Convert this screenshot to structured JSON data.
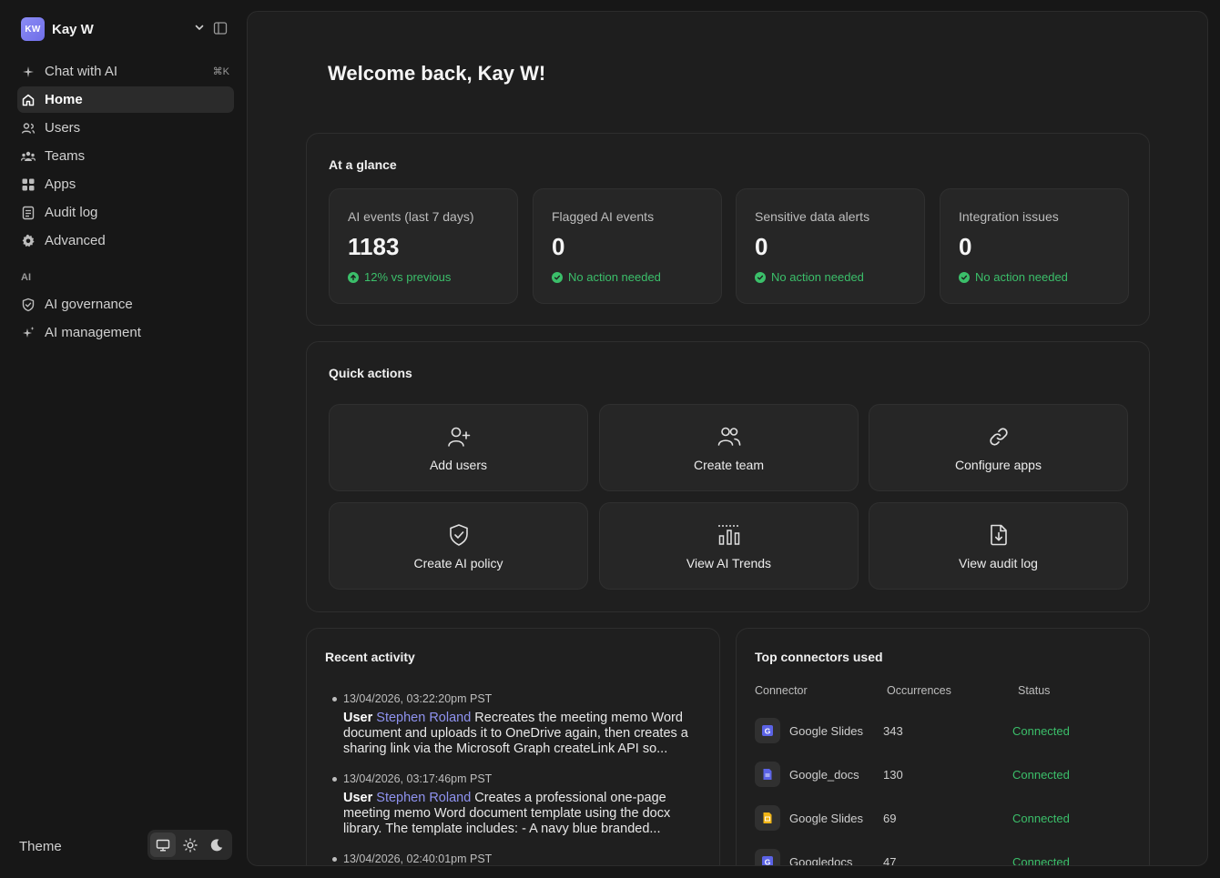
{
  "account": {
    "initials": "KW",
    "name": "Kay W"
  },
  "nav": {
    "chat": {
      "label": "Chat with AI",
      "shortcut": "⌘K"
    },
    "items": [
      {
        "label": "Home"
      },
      {
        "label": "Users"
      },
      {
        "label": "Teams"
      },
      {
        "label": "Apps"
      },
      {
        "label": "Audit log"
      },
      {
        "label": "Advanced"
      }
    ],
    "ai_section_label": "AI",
    "ai_items": [
      {
        "label": "AI governance"
      },
      {
        "label": "AI management"
      }
    ]
  },
  "theme": {
    "label": "Theme"
  },
  "welcome": "Welcome back, Kay W!",
  "glance": {
    "title": "At a glance",
    "stats": [
      {
        "label": "AI events (last 7 days)",
        "value": "1183",
        "foot": "12% vs previous"
      },
      {
        "label": "Flagged AI events",
        "value": "0",
        "foot": "No action needed"
      },
      {
        "label": "Sensitive data alerts",
        "value": "0",
        "foot": "No action needed"
      },
      {
        "label": "Integration issues",
        "value": "0",
        "foot": "No action needed"
      }
    ]
  },
  "quick_actions": {
    "title": "Quick actions",
    "items": [
      {
        "label": "Add users"
      },
      {
        "label": "Create team"
      },
      {
        "label": "Configure apps"
      },
      {
        "label": "Create AI policy"
      },
      {
        "label": "View AI Trends"
      },
      {
        "label": "View audit log"
      }
    ]
  },
  "recent": {
    "title": "Recent activity",
    "items": [
      {
        "time": "13/04/2026, 03:22:20pm PST",
        "prefix": "User",
        "user": "Stephen Roland",
        "text": " Recreates the meeting memo Word document and uploads it to OneDrive again, then creates a sharing link via the Microsoft Graph createLink API so..."
      },
      {
        "time": "13/04/2026, 03:17:46pm PST",
        "prefix": "User",
        "user": "Stephen Roland",
        "text": " Creates a professional one-page meeting memo Word document template using the docx library. The template includes: - A navy blue branded..."
      },
      {
        "time": "13/04/2026, 02:40:01pm PST",
        "prefix": "",
        "user": "",
        "text": ""
      }
    ]
  },
  "connectors": {
    "title": "Top connectors used",
    "headers": {
      "connector": "Connector",
      "occurrences": "Occurrences",
      "status": "Status"
    },
    "rows": [
      {
        "name": "Google Slides",
        "occurrences": "343",
        "status": "Connected",
        "icon": "google-slides-icon"
      },
      {
        "name": "Google_docs",
        "occurrences": "130",
        "status": "Connected",
        "icon": "google-docs-icon"
      },
      {
        "name": "Google Slides",
        "occurrences": "69",
        "status": "Connected",
        "icon": "google-slides-yellow-icon"
      },
      {
        "name": "Googledocs",
        "occurrences": "47",
        "status": "Connected",
        "icon": "google-docs-icon"
      }
    ]
  },
  "colors": {
    "accent": "#8f93f0",
    "success": "#3bbf6a",
    "background": "#171717",
    "panel": "#1e1e1e"
  }
}
